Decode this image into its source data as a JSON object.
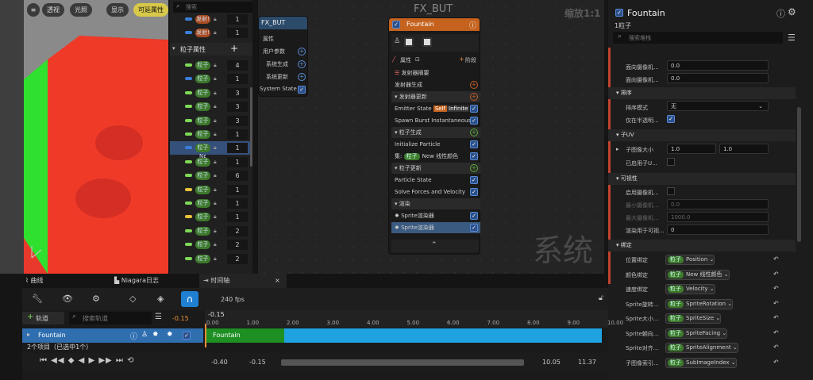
{
  "viewport": {
    "buttons": [
      "透视",
      "光照",
      "显示",
      "可延属性"
    ],
    "search_placeholder": "搜索"
  },
  "particle_list": {
    "top_rows": [
      {
        "label": "发射!",
        "value": "1"
      },
      {
        "label": "发射!",
        "value": "1"
      }
    ],
    "section": "粒子属性",
    "add_icon": "plus-icon",
    "rows": [
      {
        "label": "粒子",
        "value": "4",
        "color": "#7ed957"
      },
      {
        "label": "粒子",
        "value": "1",
        "color": "#3b7dd8"
      },
      {
        "label": "粒子",
        "value": "3",
        "color": "#7ed957"
      },
      {
        "label": "粒子",
        "value": "3",
        "color": "#7ed957"
      },
      {
        "label": "粒子",
        "value": "3",
        "color": "#7ed957"
      },
      {
        "label": "粒子",
        "value": "1",
        "color": "#7ed957"
      },
      {
        "label": "粒子 Nε",
        "value": "1",
        "color": "#3b7dd8"
      },
      {
        "label": "粒子",
        "value": "1",
        "color": "#7ed957"
      },
      {
        "label": "粒子",
        "value": "6",
        "color": "#7ed957"
      },
      {
        "label": "粒子",
        "value": "1",
        "color": "#e8c23a"
      },
      {
        "label": "粒子",
        "value": "1",
        "color": "#7ed957"
      },
      {
        "label": "粒子",
        "value": "1",
        "color": "#e8c23a"
      },
      {
        "label": "粒子",
        "value": "2",
        "color": "#7ed957"
      },
      {
        "label": "粒子",
        "value": "2",
        "color": "#7ed957"
      },
      {
        "label": "粒子",
        "value": "2",
        "color": "#7ed957"
      }
    ]
  },
  "graph": {
    "title": "FX_BUT",
    "zoom": "缩放1:1",
    "watermark": "系统",
    "system_node": {
      "title": "FX_BUT",
      "rows": [
        "属性",
        "用户参数",
        "系统生成",
        "系统更新",
        "System State"
      ]
    },
    "emitter_node": {
      "title": "Fountain",
      "attr_label": "属性",
      "stage_label": "阶段",
      "summary": "发射器摘要",
      "emitter_spawn": "发射器生成",
      "emitter_update": "发射器更新",
      "emitter_state": "Emitter State",
      "self_tag": "Self",
      "infinite_tag": "Infinite",
      "spawn_burst": "Spawn Burst Instantaneous",
      "particle_spawn": "粒子生成",
      "init_particle": "Initialize Particle",
      "set_prefix": "集:",
      "set_pill": "粒子",
      "set_value": "New 线性颜色",
      "particle_update": "粒子更新",
      "particle_state": "Particle State",
      "solve_forces": "Solve Forces and Velocity",
      "render": "渲染",
      "sprite1": "Sprite渲染器",
      "sprite2": "Sprite渲染器"
    }
  },
  "details": {
    "title": "Fountain",
    "subtitle": "1粒子",
    "search_placeholder": "搜索堆栈",
    "rows_top": [
      {
        "label": "面向摄像机...",
        "value": "0.0"
      },
      {
        "label": "面向摄像机...",
        "value": "0.0"
      }
    ],
    "sort_section": "排序",
    "sort_mode_label": "排序模式",
    "sort_mode_value": "无",
    "only_translucent_label": "仅在半透明...",
    "subuv_section": "子UV",
    "subimage_size_label": "子图像大小",
    "subimage_x": "1.0",
    "subimage_y": "1.0",
    "enable_subuv_label": "已启用子U...",
    "visibility_section": "可视性",
    "enable_camera_label": "启用摄像机...",
    "min_camera_label": "最小摄像机...",
    "min_camera_value": "0.0",
    "max_camera_label": "最大摄像机...",
    "max_camera_value": "1000.0",
    "render_visible_label": "渲染用于可视...",
    "render_visible_value": "0",
    "binding_section": "绑定",
    "bindings": [
      {
        "label": "位置绑定",
        "pill": "粒子",
        "value": "Position"
      },
      {
        "label": "颜色绑定",
        "pill": "粒子",
        "value": "New 线性颜色"
      },
      {
        "label": "速度绑定",
        "pill": "粒子",
        "value": "Velocity"
      },
      {
        "label": "Sprite旋转...",
        "pill": "粒子",
        "value": "SpriteRotation"
      },
      {
        "label": "Sprite大小...",
        "pill": "粒子",
        "value": "SpriteSize"
      },
      {
        "label": "Sprite朝向...",
        "pill": "粒子",
        "value": "SpriteFacing"
      },
      {
        "label": "Sprite对齐...",
        "pill": "粒子",
        "value": "SpriteAlignment"
      },
      {
        "label": "子图像索引...",
        "pill": "粒子",
        "value": "SubImageIndex"
      }
    ]
  },
  "timeline": {
    "tabs": [
      "曲线",
      "Niagara日志",
      "时间轴"
    ],
    "fps": "240 fps",
    "add_track": "轨道",
    "search_placeholder": "搜索轨道",
    "current_time": "-0.15",
    "playhead_label": "-0.15",
    "ticks": [
      "0.00",
      "1.00",
      "2.00",
      "3.00",
      "4.00",
      "5.00",
      "6.00",
      "7.00",
      "8.00",
      "9.00",
      "10.00"
    ],
    "track_name": "Fountain",
    "bar_label": "Fountain",
    "status": "2个项目（已选中1个）",
    "range_start": "-0.40",
    "range_view_start": "-0.15",
    "range_view_end": "10.05",
    "range_end": "11.37"
  },
  "colors": {
    "accent": "#1fa3e0",
    "green": "#3d7a2c",
    "orange": "#d9652a"
  }
}
